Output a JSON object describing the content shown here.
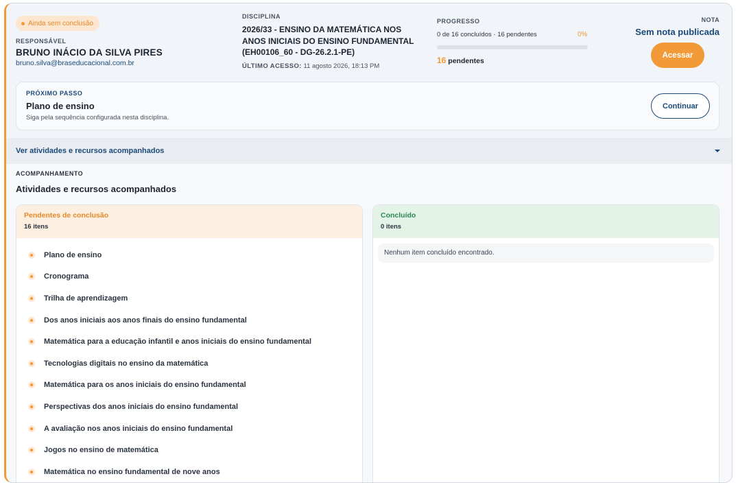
{
  "status_badge": "Ainda sem conclusão",
  "responsavel": {
    "label": "RESPONSÁVEL",
    "name": "BRUNO INÁCIO DA SILVA PIRES",
    "email": "bruno.silva@braseducacional.com.br"
  },
  "disciplina": {
    "label": "DISCIPLINA",
    "title": "2026/33 - ENSINO DA MATEMÁTICA NOS ANOS INICIAIS DO ENSINO FUNDAMENTAL (EH00106_60 - DG-26.2.1-PE)",
    "last_access_label": "ÚLTIMO ACESSO:",
    "last_access_value": "11 agosto 2026, 18:13 PM"
  },
  "progresso": {
    "label": "PROGRESSO",
    "summary": "0 de 16 concluídos · 16 pendentes",
    "percent_label": "0%",
    "percent": 0,
    "pending_count": "16",
    "pending_label": "pendentes"
  },
  "nota": {
    "label": "NOTA",
    "value": "Sem nota publicada"
  },
  "acessar_button": "Acessar",
  "proximo_passo": {
    "label": "PRÓXIMO PASSO",
    "title": "Plano de ensino",
    "description": "Siga pela sequência configurada nesta disciplina.",
    "button": "Continuar"
  },
  "toggle_label": "Ver atividades e recursos acompanhados",
  "acompanhamento": {
    "label": "ACOMPANHAMENTO",
    "title": "Atividades e recursos acompanhados"
  },
  "pendentes": {
    "title": "Pendentes de conclusão",
    "count": "16 itens",
    "items": [
      "Plano de ensino",
      "Cronograma",
      "Trilha de aprendizagem",
      "Dos anos iniciais aos anos finais do ensino fundamental",
      "Matemática para a educação infantil e anos iniciais do ensino fundamental",
      "Tecnologias digitais no ensino da matemática",
      "Matemática para os anos iniciais do ensino fundamental",
      "Perspectivas dos anos iniciais do ensino fundamental",
      "A avaliação nos anos iniciais do ensino fundamental",
      "Jogos no ensino de matemática",
      "Matemática no ensino fundamental de nove anos"
    ]
  },
  "concluido": {
    "title": "Concluído",
    "count": "0 itens",
    "empty": "Nenhum item concluído encontrado."
  },
  "colors": {
    "accent_orange": "#f29a38",
    "primary_blue": "#1b4a7a",
    "success_green": "#2f8a4f"
  }
}
